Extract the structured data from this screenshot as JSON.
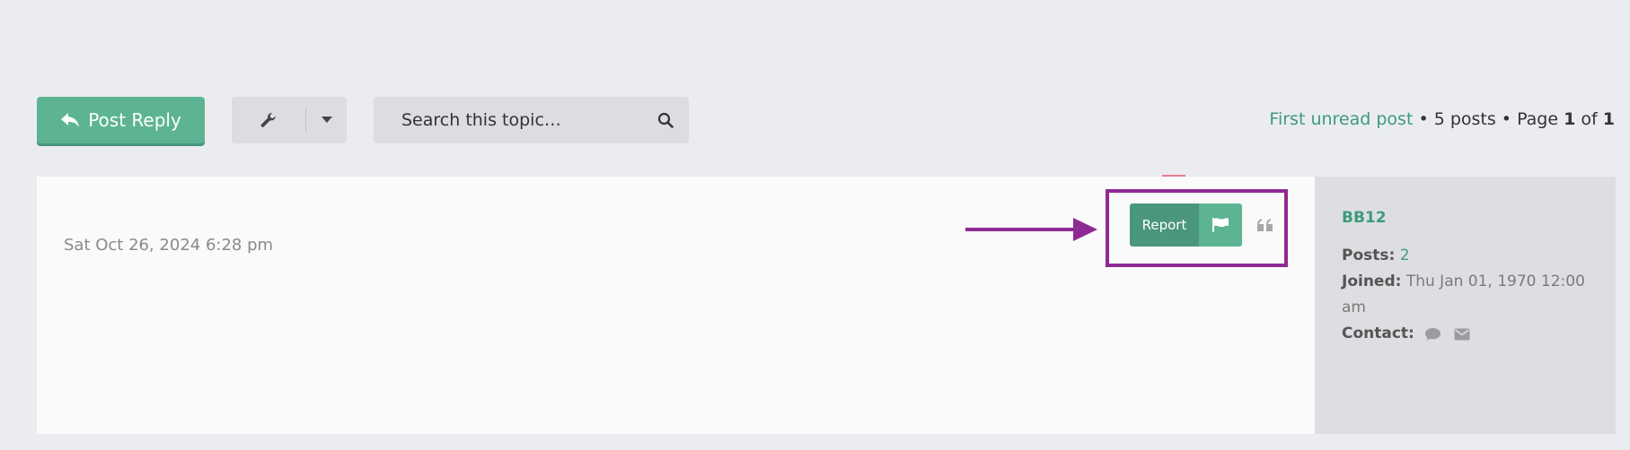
{
  "action_bar": {
    "post_reply_label": "Post Reply",
    "search_placeholder": "Search this topic…",
    "pagination": {
      "first_unread_label": "First unread post",
      "separator": " • ",
      "posts_count_text": "5 posts",
      "page_prefix": "Page",
      "current_page": "1",
      "of_text": "of",
      "total_pages": "1"
    }
  },
  "post": {
    "date": "Sat Oct 26, 2024 6:28 pm",
    "report_label": "Report"
  },
  "profile": {
    "username": "BB12",
    "posts_label": "Posts:",
    "posts_value": "2",
    "joined_label": "Joined:",
    "joined_value": "Thu Jan 01, 1970 12:00 am",
    "contact_label": "Contact:"
  },
  "icons": {
    "post_reply": "reply-icon",
    "tools": "wrench-icon",
    "tools_dropdown": "caret-down-icon",
    "search": "search-icon",
    "report_flag": "flag-icon",
    "quote": "quote-icon",
    "contact_pm": "comment-icon",
    "contact_email": "envelope-icon"
  },
  "colors": {
    "accent": "#5cb493",
    "accent_dark": "#4a977b",
    "link": "#3d9a7a",
    "annotation": "#8e2a94",
    "page_bg": "#ebecf0"
  }
}
